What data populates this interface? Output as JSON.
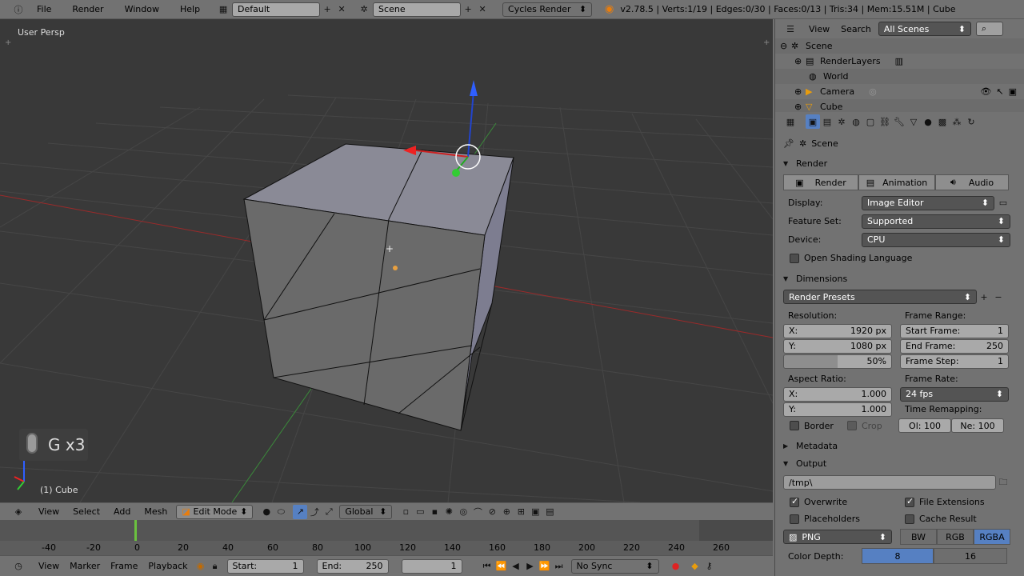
{
  "topbar": {
    "menus": [
      "File",
      "Render",
      "Window",
      "Help"
    ],
    "layout": "Default",
    "scene": "Scene",
    "engine": "Cycles Render",
    "stats": "v2.78.5 | Verts:1/19 | Edges:0/30 | Faces:0/13 | Tris:34 | Mem:15.51M | Cube"
  },
  "viewport": {
    "view_label": "User Persp",
    "object_label": "(1) Cube",
    "keycast": "G x3"
  },
  "vpheader": {
    "menus": [
      "View",
      "Select",
      "Add",
      "Mesh"
    ],
    "mode": "Edit Mode",
    "orientation": "Global"
  },
  "timeline": {
    "ticks": [
      "-40",
      "-20",
      "0",
      "20",
      "40",
      "60",
      "80",
      "100",
      "120",
      "140",
      "160",
      "180",
      "200",
      "220",
      "240",
      "260"
    ],
    "menus": [
      "View",
      "Marker",
      "Frame",
      "Playback"
    ],
    "start_label": "Start:",
    "start": "1",
    "end_label": "End:",
    "end": "250",
    "current": "1",
    "sync": "No Sync"
  },
  "outliner": {
    "menus": [
      "View",
      "Search"
    ],
    "filter": "All Scenes",
    "items": [
      "Scene",
      "RenderLayers",
      "World",
      "Camera",
      "Cube"
    ]
  },
  "properties": {
    "context": "Scene",
    "render_section": "Render",
    "tabs": [
      "Render",
      "Animation",
      "Audio"
    ],
    "display_label": "Display:",
    "display": "Image Editor",
    "feature_label": "Feature Set:",
    "feature": "Supported",
    "device_label": "Device:",
    "device": "CPU",
    "osl": "Open Shading Language",
    "dimensions_section": "Dimensions",
    "presets": "Render Presets",
    "resolution_label": "Resolution:",
    "res_x_label": "X:",
    "res_x": "1920 px",
    "res_y_label": "Y:",
    "res_y": "1080 px",
    "res_pct": "50%",
    "frame_range_label": "Frame Range:",
    "start_frame_label": "Start Frame:",
    "start_frame": "1",
    "end_frame_label": "End Frame:",
    "end_frame": "250",
    "frame_step_label": "Frame Step:",
    "frame_step": "1",
    "aspect_label": "Aspect Ratio:",
    "asp_x_label": "X:",
    "asp_x": "1.000",
    "asp_y_label": "Y:",
    "asp_y": "1.000",
    "frame_rate_label": "Frame Rate:",
    "frame_rate": "24 fps",
    "time_remap_label": "Time Remapping:",
    "remap_old": "Ol: 100",
    "remap_new": "Ne: 100",
    "border": "Border",
    "crop": "Crop",
    "metadata_section": "Metadata",
    "output_section": "Output",
    "output_path": "/tmp\\",
    "overwrite": "Overwrite",
    "file_ext": "File Extensions",
    "placeholders": "Placeholders",
    "cache_result": "Cache Result",
    "format": "PNG",
    "color_modes": [
      "BW",
      "RGB",
      "RGBA"
    ],
    "color_depth_label": "Color Depth:",
    "depths": [
      "8",
      "16"
    ]
  }
}
